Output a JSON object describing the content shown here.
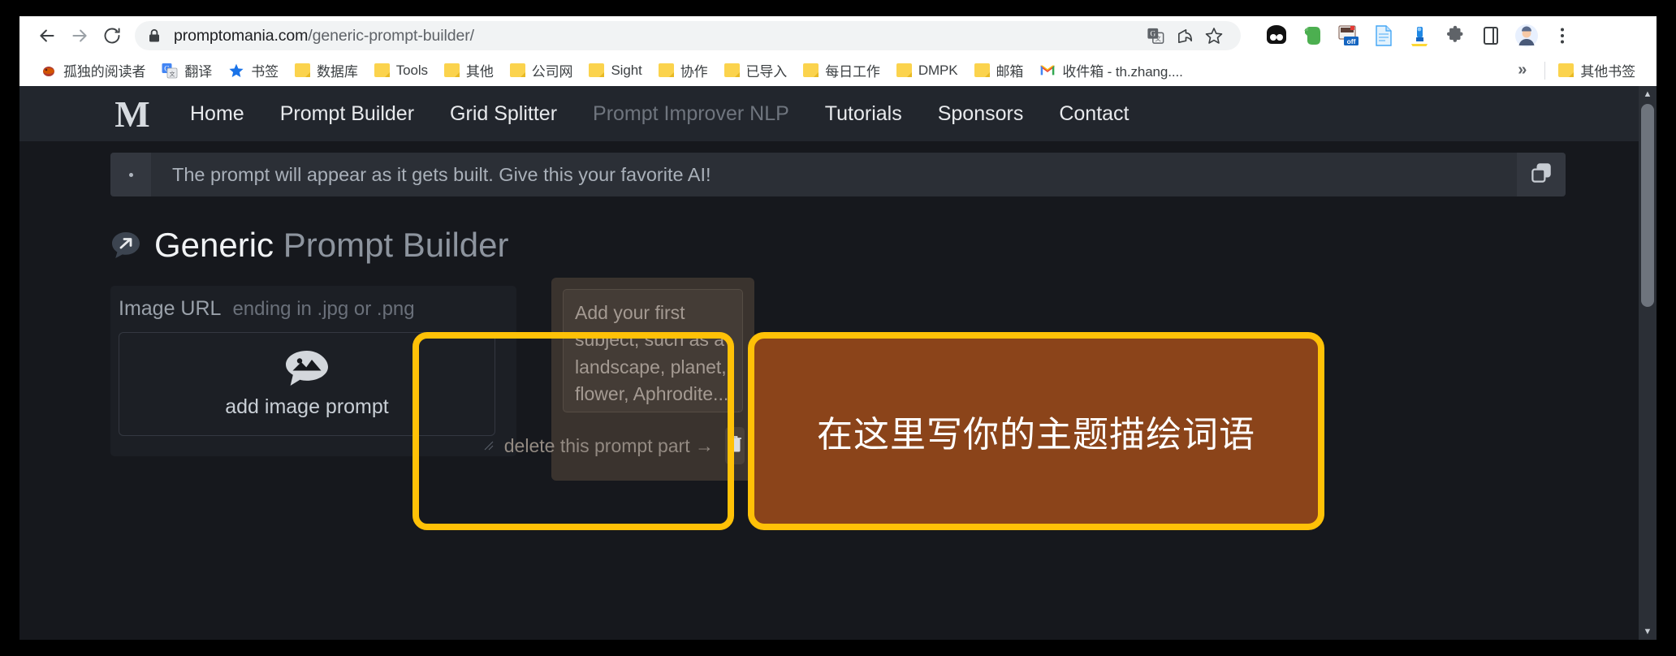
{
  "browser": {
    "nav": {
      "back": "back-arrow",
      "forward": "forward-arrow",
      "reload": "reload"
    },
    "omnibox": {
      "domain": "promptomania.com",
      "path": "/generic-prompt-builder/",
      "lock": "lock-icon"
    },
    "omnibox_icons": [
      "translate-icon",
      "share-icon",
      "bookmark-star-icon"
    ],
    "extension_icons": [
      "eyes-extension-icon",
      "evernote-icon",
      "adblock-off-icon",
      "document-icon",
      "microscope-icon",
      "puzzle-extensions-icon",
      "sidepanel-icon",
      "profile-avatar-icon",
      "chrome-menu-icon"
    ],
    "bookmarks": [
      {
        "label": "孤独的阅读者",
        "icon": "site-favicon"
      },
      {
        "label": "翻译",
        "icon": "google-translate-icon"
      },
      {
        "label": "书签",
        "icon": "blue-star-icon"
      },
      {
        "label": "数据库",
        "icon": "folder-icon"
      },
      {
        "label": "Tools",
        "icon": "folder-icon"
      },
      {
        "label": "其他",
        "icon": "folder-icon"
      },
      {
        "label": "公司网",
        "icon": "folder-icon"
      },
      {
        "label": "Sight",
        "icon": "folder-icon"
      },
      {
        "label": "协作",
        "icon": "folder-icon"
      },
      {
        "label": "已导入",
        "icon": "folder-icon"
      },
      {
        "label": "每日工作",
        "icon": "folder-icon"
      },
      {
        "label": "DMPK",
        "icon": "folder-icon"
      },
      {
        "label": "邮箱",
        "icon": "folder-icon"
      },
      {
        "label": "收件箱 - th.zhang....",
        "icon": "gmail-icon"
      }
    ],
    "bookmarks_overflow": "»",
    "other_bookmarks": {
      "label": "其他书签",
      "icon": "folder-icon"
    }
  },
  "site": {
    "logo": "promptomania-logo",
    "nav_links": [
      {
        "label": "Home",
        "muted": false
      },
      {
        "label": "Prompt Builder",
        "muted": false
      },
      {
        "label": "Grid Splitter",
        "muted": false
      },
      {
        "label": "Prompt Improver NLP",
        "muted": true
      },
      {
        "label": "Tutorials",
        "muted": false
      },
      {
        "label": "Sponsors",
        "muted": false
      },
      {
        "label": "Contact",
        "muted": false
      }
    ],
    "prompt_bar": {
      "menu_icon": "kebab-menu-icon",
      "placeholder": "The prompt will appear as it gets built. Give this your favorite AI!",
      "copy_icon": "copy-icon"
    },
    "title": {
      "icon": "chat-arrow-icon",
      "strong": "Generic",
      "rest": " Prompt Builder"
    },
    "image_card": {
      "url_label": "Image URL",
      "url_hint": "ending in .jpg or .png",
      "add_label": "add image prompt",
      "add_icon": "image-bubble-icon"
    },
    "prompt_part": {
      "textarea_placeholder": "Add your first subject, such as a landscape, planet, flower, Aphrodite...",
      "delete_label": "delete this prompt part →",
      "delete_icon": "trash-icon"
    },
    "scrollbar": {
      "up": "▲",
      "down": "▼"
    }
  },
  "annotations": {
    "highlight_color": "#FFC107",
    "note_fill": "#8B441A",
    "note_text": "在这里写你的主题描绘词语"
  }
}
